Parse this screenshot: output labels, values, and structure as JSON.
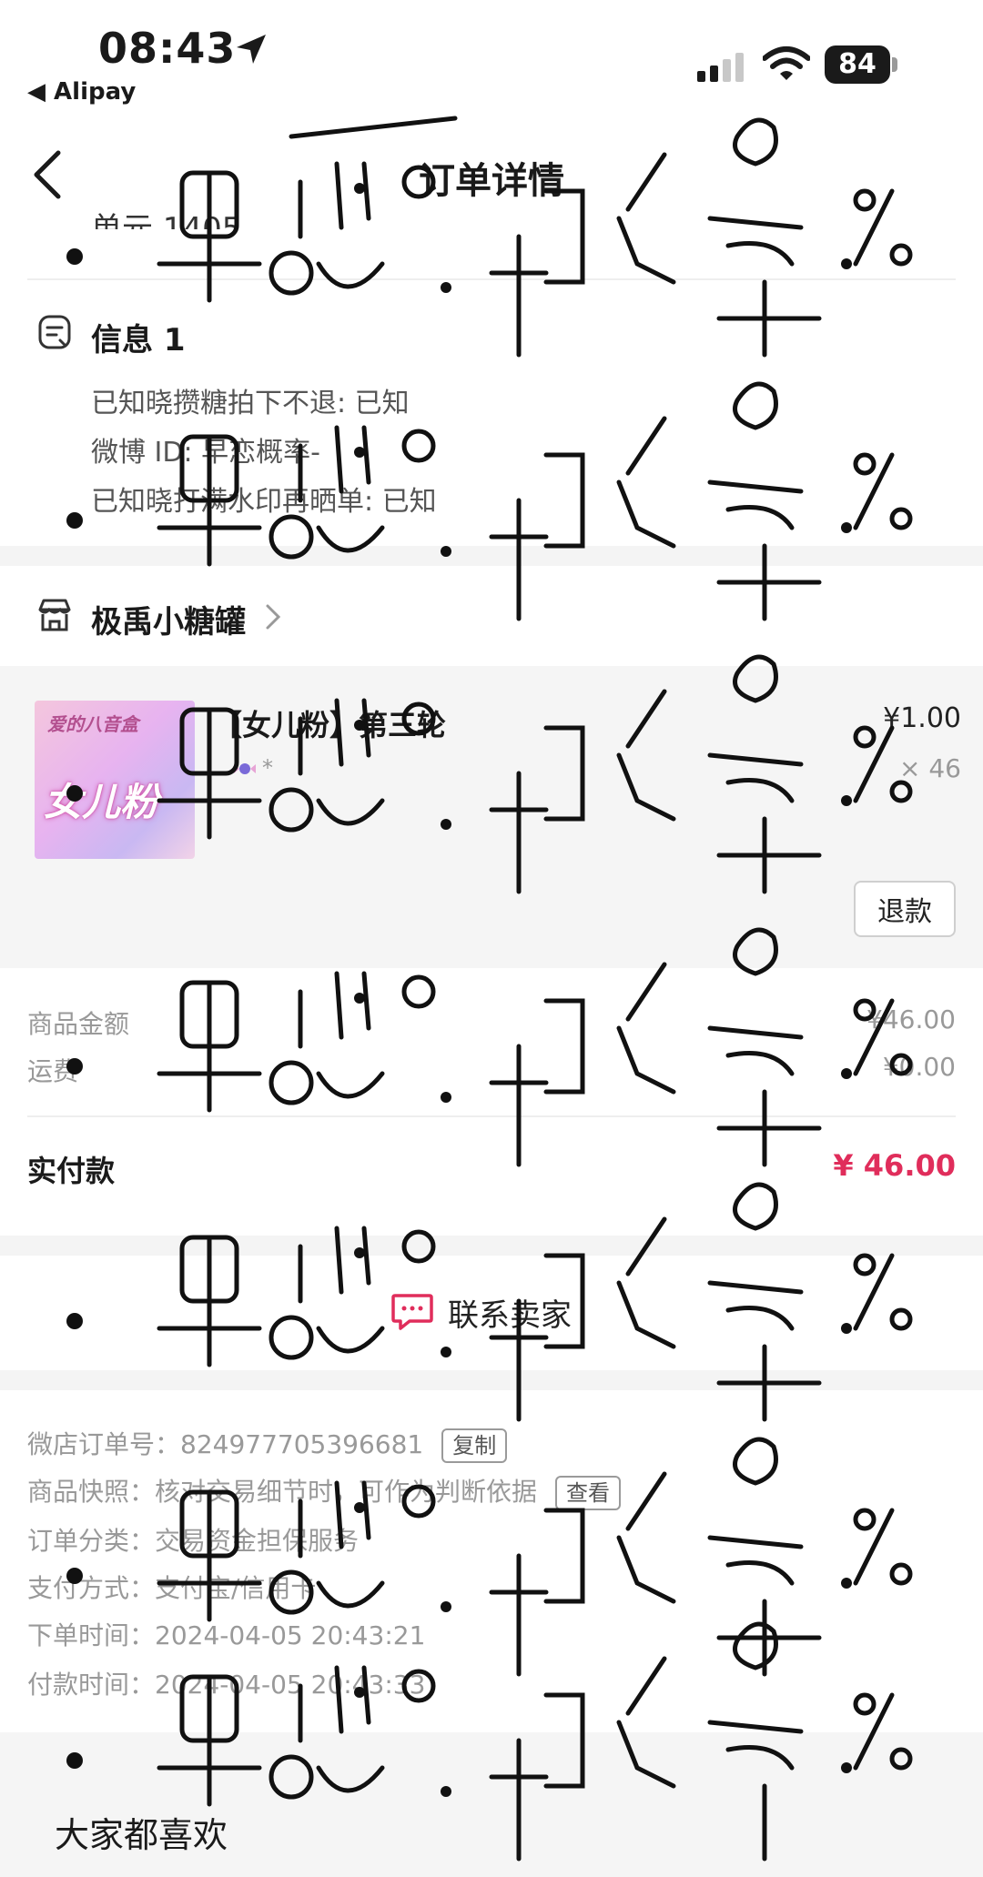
{
  "status_bar": {
    "time": "08:43",
    "back_app": "◀ Alipay",
    "battery": "84"
  },
  "nav": {
    "title": "订单详情"
  },
  "partial_line": "单元 1405",
  "info": {
    "title": "信息 1",
    "lines": [
      "已知晓攒糖拍下不退: 已知",
      "微博 ID: 早恋概率-",
      "已知晓打满水印再晒单: 已知"
    ]
  },
  "shop": {
    "name": "极禹小糖罐"
  },
  "product": {
    "image_text_top": "爱的八音盒",
    "image_text_main": "女儿粉",
    "title": "【女儿粉】第三轮",
    "spec": "*",
    "price": "¥1.00",
    "quantity": "× 46",
    "refund_label": "退款"
  },
  "amounts": {
    "goods_label": "商品金额",
    "goods_value": "¥46.00",
    "shipping_label": "运费",
    "shipping_value": "¥0.00",
    "paid_label": "实付款",
    "paid_value": "¥ 46.00"
  },
  "contact": {
    "label": "联系卖家"
  },
  "order_info": {
    "order_no": "微店订单号：824977705396681",
    "copy_label": "复制",
    "snapshot": "商品快照：核对交易细节时，可作为判断依据",
    "view_label": "查看",
    "category": "订单分类：交易资金担保服务",
    "payment": "支付方式：支付宝/信用卡",
    "order_time": "下单时间：2024-04-05 20:43:21",
    "pay_time": "付款时间：2024-04-05 20:43:33"
  },
  "recommend": {
    "title": "大家都喜欢"
  },
  "watermark_text": "早恋概率%",
  "colors": {
    "price_red": "#e02d5b",
    "gap_gray": "#f4f4f4",
    "muted_text": "#999999"
  }
}
